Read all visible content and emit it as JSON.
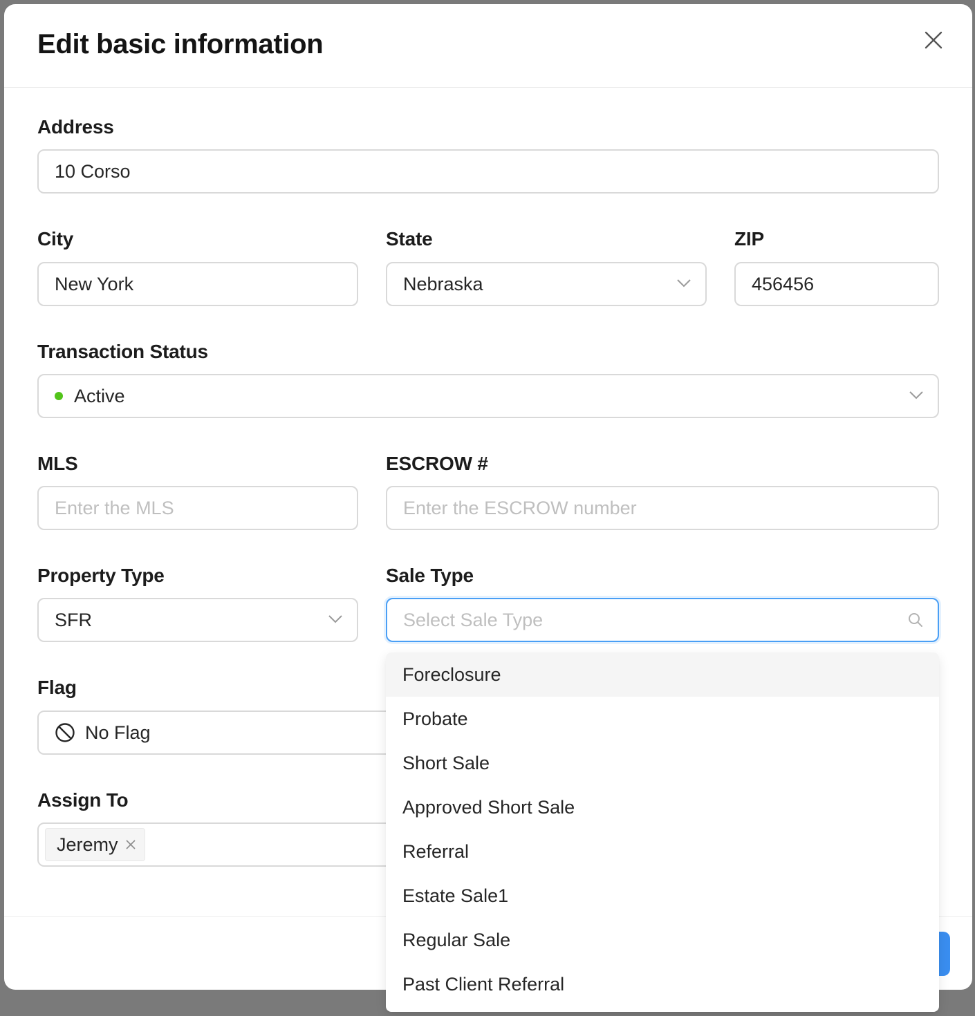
{
  "modal": {
    "title": "Edit basic information"
  },
  "address": {
    "label": "Address",
    "value": "10 Corso"
  },
  "city": {
    "label": "City",
    "value": "New York"
  },
  "state": {
    "label": "State",
    "value": "Nebraska"
  },
  "zip": {
    "label": "ZIP",
    "value": "456456"
  },
  "transaction_status": {
    "label": "Transaction Status",
    "value": "Active",
    "status_color": "#52c41a"
  },
  "mls": {
    "label": "MLS",
    "placeholder": "Enter the MLS"
  },
  "escrow": {
    "label": "ESCROW #",
    "placeholder": "Enter the ESCROW number"
  },
  "property_type": {
    "label": "Property Type",
    "value": "SFR"
  },
  "sale_type": {
    "label": "Sale Type",
    "placeholder": "Select Sale Type",
    "options": [
      "Foreclosure",
      "Probate",
      "Short Sale",
      "Approved Short Sale",
      "Referral",
      "Estate Sale1",
      "Regular Sale",
      "Past Client Referral"
    ],
    "highlighted_index": 0
  },
  "flag": {
    "label": "Flag",
    "value": "No Flag",
    "icon": "no-flag-icon"
  },
  "assign_to": {
    "label": "Assign To",
    "tags": [
      "Jeremy"
    ]
  },
  "colors": {
    "focus": "#4a9ff5",
    "primary": "#3a8ef0"
  }
}
